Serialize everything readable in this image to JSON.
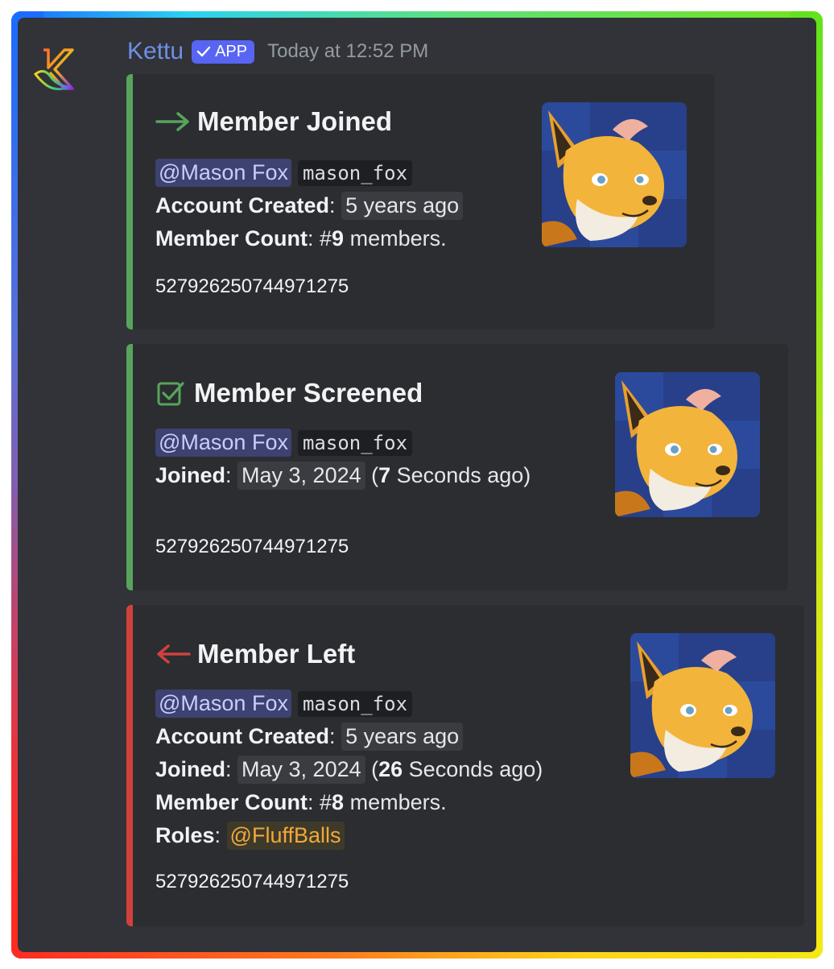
{
  "message": {
    "bot_name": "Kettu",
    "badge_label": "APP",
    "timestamp": "Today at 12:52 PM"
  },
  "colors": {
    "accent_green": "#57a45b",
    "accent_red": "#d0413e",
    "mention_bg": "#3e4270",
    "role_color": "#f0a83a",
    "bot_name_color": "#6f8fe8"
  },
  "embeds": [
    {
      "icon": "arrow-right-icon",
      "title": "Member Joined",
      "user_mention": "@Mason Fox",
      "username": "mason_fox",
      "account_created_label": "Account Created",
      "account_created_value": "5 years ago",
      "member_count_label": "Member Count",
      "member_count_prefix": "#",
      "member_count_number": "9",
      "member_count_suffix": " members.",
      "footer_id": "527926250744971275"
    },
    {
      "icon": "checkbox-icon",
      "title": "Member Screened",
      "user_mention": "@Mason Fox",
      "username": "mason_fox",
      "joined_label": "Joined",
      "joined_date": "May 3, 2024",
      "joined_ago_number": "7",
      "joined_ago_suffix": " Seconds ago)",
      "footer_id": "527926250744971275"
    },
    {
      "icon": "arrow-left-icon",
      "title": "Member Left",
      "user_mention": "@Mason Fox",
      "username": "mason_fox",
      "account_created_label": "Account Created",
      "account_created_value": "5 years ago",
      "joined_label": "Joined",
      "joined_date": "May 3, 2024",
      "joined_ago_number": "26",
      "joined_ago_suffix": " Seconds ago)",
      "member_count_label": "Member Count",
      "member_count_prefix": "#",
      "member_count_number": "8",
      "member_count_suffix": " members.",
      "roles_label": "Roles",
      "role_mention": "@FluffBalls",
      "footer_id": "527926250744971275"
    }
  ]
}
